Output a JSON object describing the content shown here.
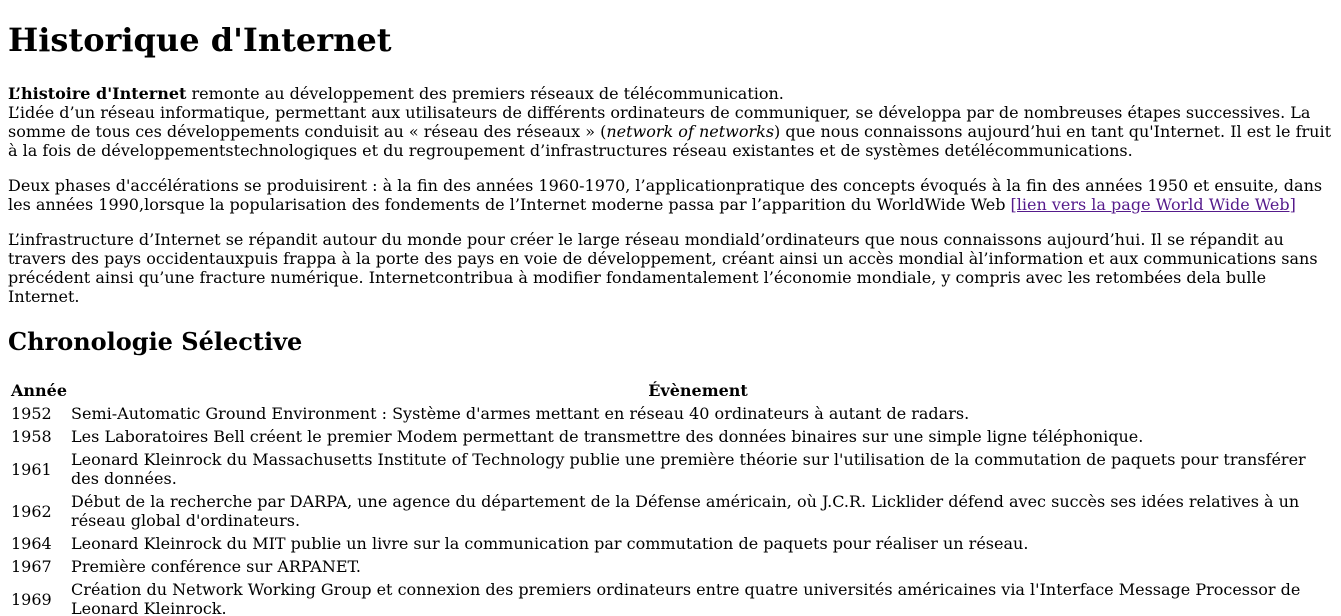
{
  "title": "Historique d'Internet",
  "intro": {
    "lead_bold": "L’histoire d'Internet",
    "lead_rest": " remonte au développement des premiers réseaux de télécommunication.",
    "p1_a": "L’idée d’un réseau informatique, permettant aux utilisateurs de différents ordinateurs de communiquer, se développa par de nombreuses étapes successives. La somme de tous ces développements conduisit au « réseau des réseaux » (",
    "p1_em": "network of networks",
    "p1_b": ") que nous connaissons aujourd’hui en tant qu'Internet. Il est le fruit à la fois de développementstechnologiques et du regroupement d’infrastructures réseau existantes et de systèmes detélécommunications.",
    "p2": "Deux phases d'accélérations se produisirent : à la fin des années 1960-1970, l’applicationpratique des concepts évoqués à la fin des années 1950 et ensuite, dans les années 1990,lorsque la popularisation des fondements de l’Internet moderne passa par l’apparition du WorldWide Web ",
    "p2_link": "[lien vers la page World Wide Web]",
    "p3": "L’infrastructure d’Internet se répandit autour du monde pour créer le large réseau mondiald’ordinateurs que nous connaissons aujourd’hui. Il se répandit au travers des pays occidentauxpuis frappa à la porte des pays en voie de développement, créant ainsi un accès mondial àl’information et aux communications sans précédent ainsi qu’une fracture numérique. Internetcontribua à modifier fondamentalement l’économie mondiale, y compris avec les retombées dela bulle Internet."
  },
  "chronology": {
    "heading": "Chronologie Sélective",
    "col_year": "Année",
    "col_event": "Évènement",
    "rows": [
      {
        "year": "1952",
        "event": "Semi-Automatic Ground Environment : Système d'armes mettant en réseau 40 ordinateurs à autant de radars."
      },
      {
        "year": "1958",
        "event": "Les Laboratoires Bell créent le premier Modem permettant de transmettre des données binaires sur une simple ligne téléphonique."
      },
      {
        "year": "1961",
        "event": "Leonard Kleinrock du Massachusetts Institute of Technology publie une première théorie sur l'utilisation de la commutation de paquets pour transférer des données."
      },
      {
        "year": "1962",
        "event": "Début de la recherche par DARPA, une agence du département de la Défense américain, où J.C.R. Licklider défend avec succès ses idées relatives à un réseau global d'ordinateurs."
      },
      {
        "year": "1964",
        "event": "Leonard Kleinrock du MIT publie un livre sur la communication par commutation de paquets pour réaliser un réseau."
      },
      {
        "year": "1967",
        "event": "Première conférence sur ARPANET."
      },
      {
        "year": "1969",
        "event": "Création du Network Working Group et connexion des premiers ordinateurs entre quatre universités américaines via l'Interface Message Processor de Leonard Kleinrock."
      }
    ]
  }
}
